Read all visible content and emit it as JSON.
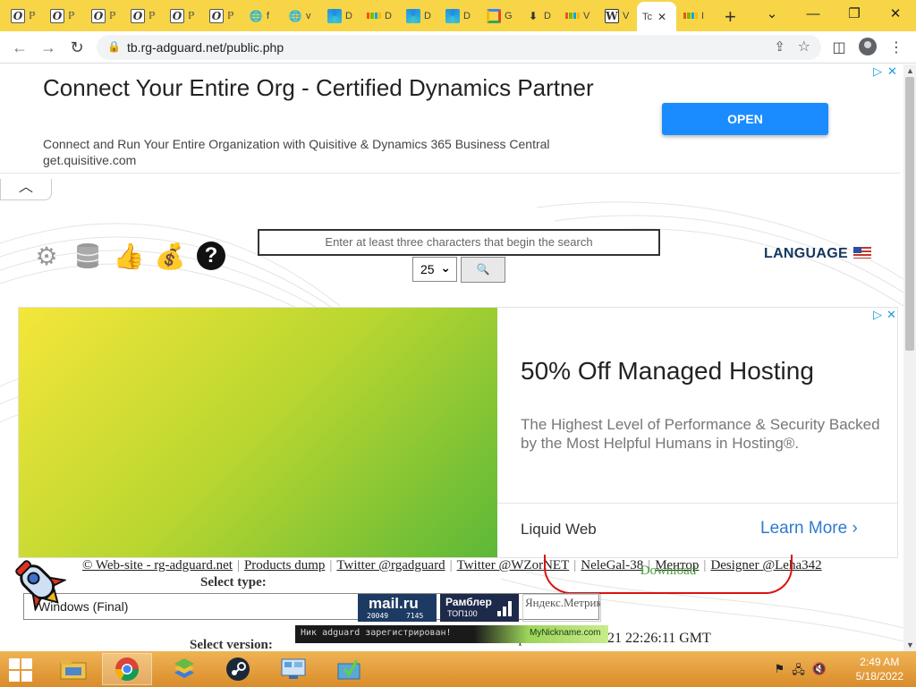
{
  "browser": {
    "tabs": [
      {
        "icon": "opera-o-icon",
        "title": "O"
      },
      {
        "icon": "opera-o-icon",
        "title": "O"
      },
      {
        "icon": "opera-o-icon",
        "title": "O"
      },
      {
        "icon": "opera-o-icon",
        "title": "O"
      },
      {
        "icon": "opera-o-icon",
        "title": "O"
      },
      {
        "icon": "opera-o-icon",
        "title": "O"
      },
      {
        "icon": "globe-icon",
        "title": "f"
      },
      {
        "icon": "globe-icon",
        "title": "v"
      },
      {
        "icon": "edge-icon",
        "title": "D"
      },
      {
        "icon": "microsoft-icon",
        "title": "D"
      },
      {
        "icon": "edge-icon",
        "title": "D"
      },
      {
        "icon": "edge-icon",
        "title": "D"
      },
      {
        "icon": "google-icon",
        "title": "G"
      },
      {
        "icon": "download-icon",
        "title": "D"
      },
      {
        "icon": "microsoft-icon",
        "title": "V"
      },
      {
        "icon": "wikipedia-icon",
        "title": "V"
      },
      {
        "icon": "tb-icon",
        "title": "Tc"
      },
      {
        "icon": "microsoft-icon",
        "title": "I"
      }
    ],
    "active_tab_index": 16,
    "url": "tb.rg-adguard.net/public.php",
    "new_tab_glyph": "+"
  },
  "top_ad": {
    "headline": "Connect Your Entire Org - Certified Dynamics Partner",
    "description": "Connect and Run Your Entire Organization with Quisitive & Dynamics 365 Business Central",
    "domain": "get.quisitive.com",
    "button": "OPEN"
  },
  "toolbar": {
    "search_placeholder": "Enter at least three characters that begin the search",
    "per_page": "25",
    "search_button_glyph": "🔍",
    "language_label": "LANGUAGE"
  },
  "big_ad": {
    "headline": "50% Off Managed Hosting",
    "sub": "The Highest Level of Performance & Security Backed by the Most Helpful Humans in Hosting®.",
    "brand": "Liquid Web",
    "cta": "Learn More"
  },
  "footer_links": [
    "© Web-site - rg-adguard.net",
    "Products dump",
    "Twitter @rgadguard",
    "Twitter @WZorNET",
    "NeleGal-38",
    "Ментор",
    "Designer @Leha342"
  ],
  "form": {
    "select_type_label": "Select type:",
    "type_value": "Windows (Final)",
    "download_label": "Download",
    "select_version_label": "Select version:",
    "last_update": "Last update: 01/11/2021 22:26:11 GMT"
  },
  "counters": {
    "mailru_name": "mail.ru",
    "mailru_n1": "20049",
    "mailru_n2": "7145",
    "rambler_name": "Рамблер",
    "rambler_top": "ТОП100",
    "broken_img_alt": "Яндекс.Метрика",
    "nick_text": "Ник adguard зарегистрирован!",
    "nick_site": "MyNickname.com"
  },
  "taskbar": {
    "apps": [
      "file-explorer-icon",
      "chrome-icon",
      "bluestacks-icon",
      "steam-icon",
      "control-panel-icon",
      "downloader-icon"
    ],
    "time": "2:49 AM",
    "date": "5/18/2022"
  },
  "colors": {
    "tabstrip": "#f7d547",
    "open_button": "#1a8cff",
    "learn_more": "#2e7bcf",
    "language": "#14375d",
    "taskbar": "#e9a443"
  }
}
